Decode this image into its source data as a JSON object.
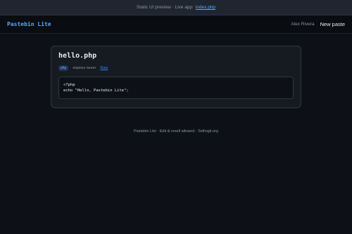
{
  "banner": {
    "text": "Static UI preview · Live app:",
    "link": "index.php"
  },
  "header": {
    "brand": "Pastebin Lite",
    "user": "Alex Rivera",
    "new_paste": "New paste"
  },
  "paste": {
    "title": "hello.php",
    "language": "php",
    "expires": "expires never",
    "raw_link": "Raw",
    "code_lines": [
      "<?php",
      "echo \"Hello, Pastebin Lite\";"
    ]
  },
  "footer": {
    "text": "Pastebin Lite · Edit & resell allowed · Sellingit.org"
  }
}
